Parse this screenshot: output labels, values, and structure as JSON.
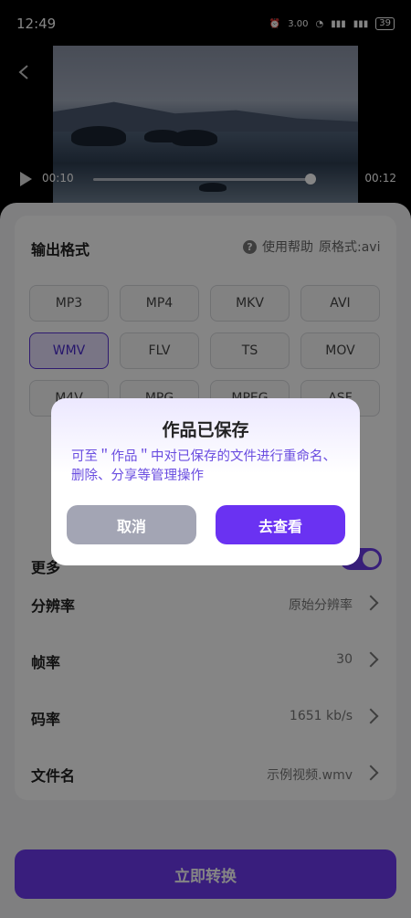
{
  "status_bar": {
    "time": "12:49",
    "network_speed": "3.00",
    "battery": "39"
  },
  "player": {
    "current_time": "00:10",
    "duration": "00:12",
    "progress": 0.98
  },
  "format": {
    "title": "输出格式",
    "help_label": "使用帮助",
    "original_format": "原格式:avi",
    "options": [
      "MP3",
      "MP4",
      "MKV",
      "AVI",
      "WMV",
      "FLV",
      "TS",
      "MOV",
      "M4V",
      "MPG",
      "MPEG",
      "ASF"
    ],
    "selected": "WMV"
  },
  "more_settings": {
    "label": "更多",
    "enabled": true
  },
  "settings": [
    {
      "label": "分辨率",
      "value": "原始分辨率"
    },
    {
      "label": "帧率",
      "value": "30"
    },
    {
      "label": "码率",
      "value": "1651 kb/s"
    },
    {
      "label": "文件名",
      "value": "示例视频.wmv"
    }
  ],
  "convert_button": "立即转换",
  "dialog": {
    "title": "作品已保存",
    "message": "可至＂作品＂中对已保存的文件进行重命名、删除、分享等管理操作",
    "cancel": "取消",
    "confirm": "去查看"
  }
}
